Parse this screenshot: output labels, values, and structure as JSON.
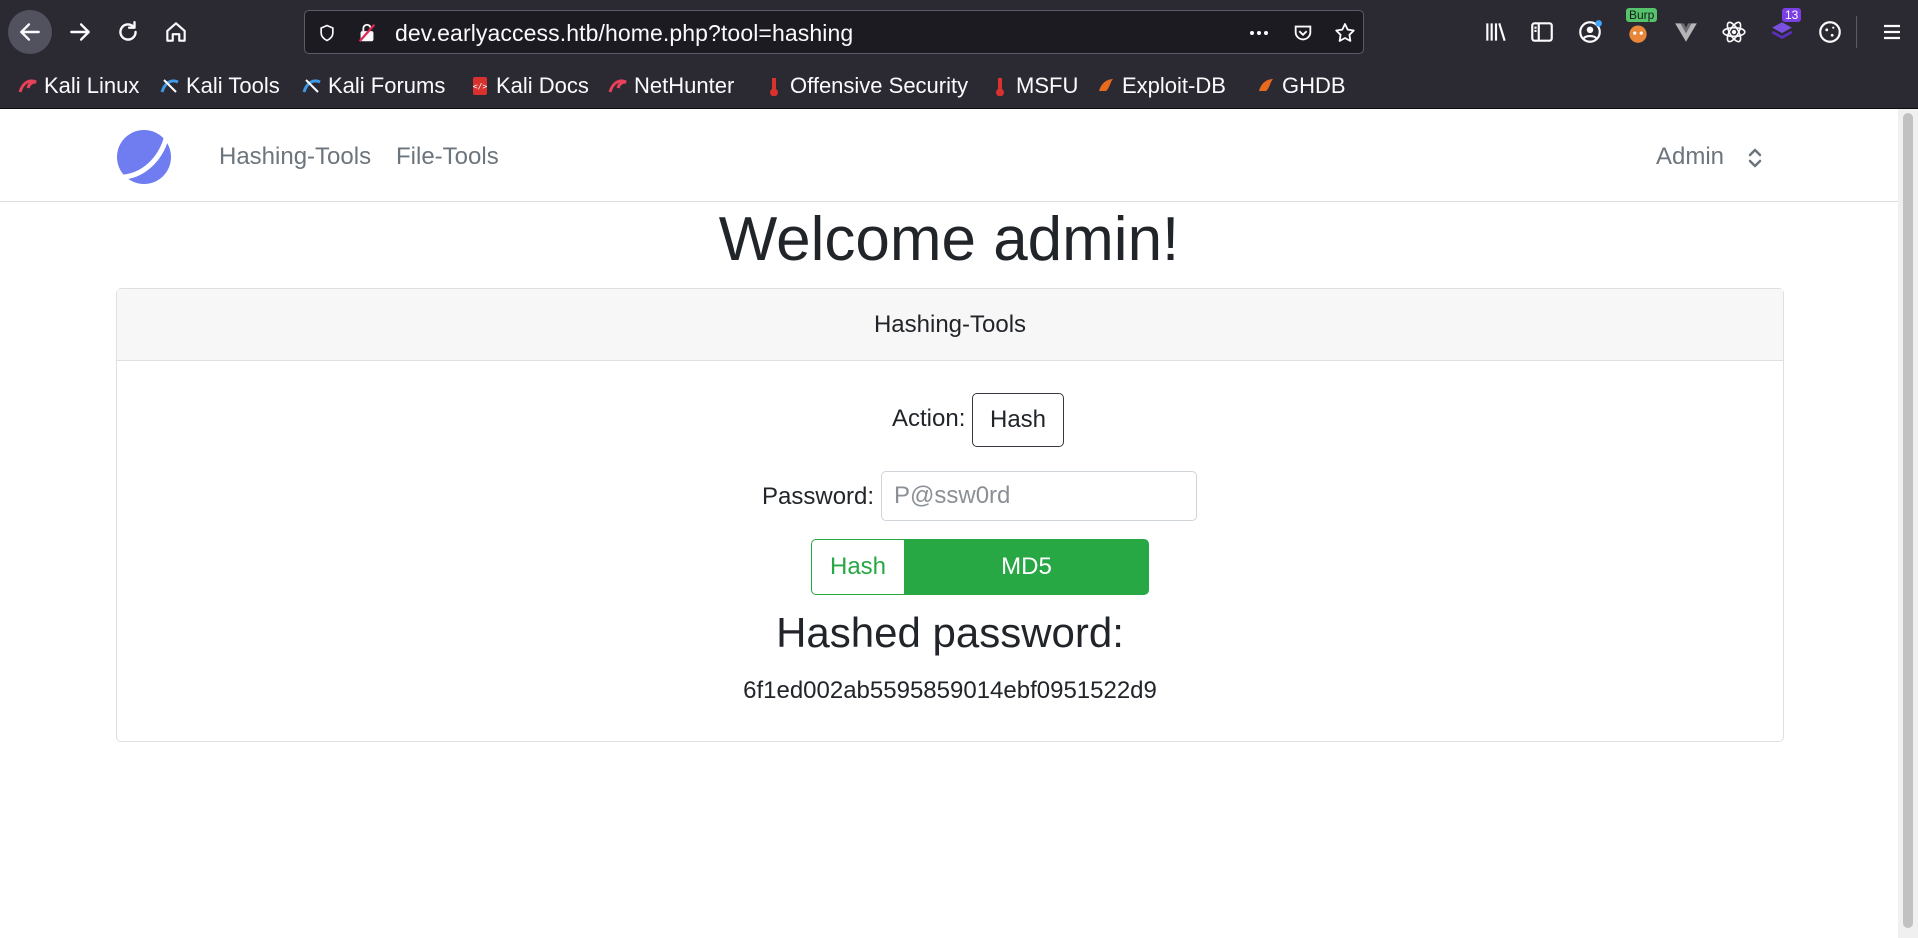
{
  "browser": {
    "url": "dev.earlyaccess.htb/home.php?tool=hashing",
    "burp_badge": "Burp",
    "ext_badge_count": "13",
    "bookmarks": [
      {
        "label": "Kali Linux",
        "icon": "kali-dragon-icon"
      },
      {
        "label": "Kali Tools",
        "icon": "kali-tools-icon"
      },
      {
        "label": "Kali Forums",
        "icon": "kali-forums-icon"
      },
      {
        "label": "Kali Docs",
        "icon": "kali-docs-icon"
      },
      {
        "label": "NetHunter",
        "icon": "nethunter-icon"
      },
      {
        "label": "Offensive Security",
        "icon": "offsec-icon"
      },
      {
        "label": "MSFU",
        "icon": "msfu-icon"
      },
      {
        "label": "Exploit-DB",
        "icon": "exploit-db-icon"
      },
      {
        "label": "GHDB",
        "icon": "ghdb-icon"
      }
    ]
  },
  "navbar": {
    "links": [
      "Hashing-Tools",
      "File-Tools"
    ],
    "user": "Admin"
  },
  "main": {
    "welcome": "Welcome admin!",
    "card_title": "Hashing-Tools",
    "action_label": "Action:",
    "action_button": "Hash",
    "password_label": "Password:",
    "password_placeholder": "P@ssw0rd",
    "hash_button": "Hash",
    "algorithm": "MD5",
    "result_title": "Hashed password:",
    "result_value": "6f1ed002ab5595859014ebf0951522d9"
  },
  "colors": {
    "accent_green": "#28a745",
    "logo_blue": "#6f7df0",
    "chrome_bg": "#2b2a33"
  }
}
